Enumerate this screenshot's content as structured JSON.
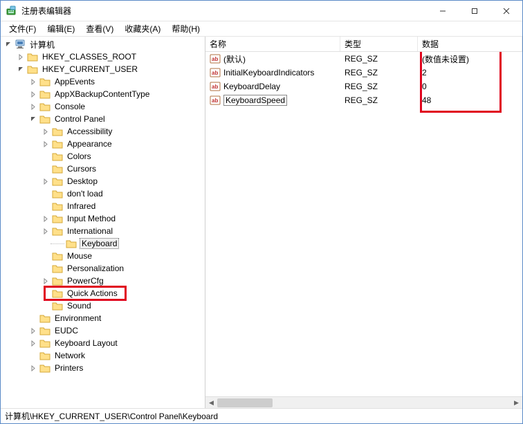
{
  "window": {
    "title": "注册表编辑器"
  },
  "menu": {
    "file": "文件(F)",
    "edit": "编辑(E)",
    "view": "查看(V)",
    "fav": "收藏夹(A)",
    "help": "帮助(H)"
  },
  "tree": {
    "root": "计算机",
    "hkcr": "HKEY_CLASSES_ROOT",
    "hkcu": "HKEY_CURRENT_USER",
    "hkcu_children": {
      "appevents": "AppEvents",
      "appx": "AppXBackupContentType",
      "console": "Console",
      "cpanel": "Control Panel",
      "cpanel_children": {
        "accessibility": "Accessibility",
        "appearance": "Appearance",
        "colors": "Colors",
        "cursors": "Cursors",
        "desktop": "Desktop",
        "dontload": "don't load",
        "infrared": "Infrared",
        "inputmethod": "Input Method",
        "international": "International",
        "keyboard": "Keyboard",
        "mouse": "Mouse",
        "personalization": "Personalization",
        "powercfg": "PowerCfg",
        "quickactions": "Quick Actions",
        "sound": "Sound"
      },
      "environment": "Environment",
      "eudc": "EUDC",
      "kblayout": "Keyboard Layout",
      "network": "Network",
      "printers": "Printers"
    }
  },
  "columns": {
    "name": "名称",
    "type": "类型",
    "data": "数据"
  },
  "values": [
    {
      "name": "(默认)",
      "type": "REG_SZ",
      "data": "(数值未设置)"
    },
    {
      "name": "InitialKeyboardIndicators",
      "type": "REG_SZ",
      "data": "2"
    },
    {
      "name": "KeyboardDelay",
      "type": "REG_SZ",
      "data": "0"
    },
    {
      "name": "KeyboardSpeed",
      "type": "REG_SZ",
      "data": "48"
    }
  ],
  "statusbar": {
    "path": "计算机\\HKEY_CURRENT_USER\\Control Panel\\Keyboard"
  }
}
